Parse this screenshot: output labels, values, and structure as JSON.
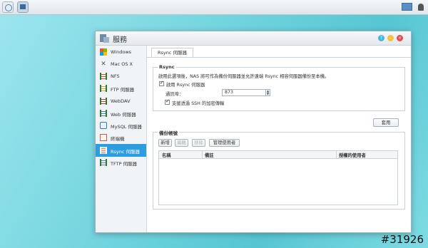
{
  "window": {
    "title": "服務"
  },
  "sidebar": {
    "items": [
      {
        "label": "Windows",
        "icon": "windows-icon"
      },
      {
        "label": "Mac OS X",
        "icon": "mac-icon"
      },
      {
        "label": "NFS",
        "icon": "nfs-icon"
      },
      {
        "label": "FTP 伺服器",
        "icon": "ftp-icon"
      },
      {
        "label": "WebDAV",
        "icon": "webdav-icon"
      },
      {
        "label": "Web 伺服器",
        "icon": "web-server-icon"
      },
      {
        "label": "MySQL 伺服器",
        "icon": "mysql-icon"
      },
      {
        "label": "終端機",
        "icon": "terminal-icon"
      },
      {
        "label": "Rsync 伺服器",
        "icon": "rsync-icon",
        "active": true
      },
      {
        "label": "TFTP 伺服器",
        "icon": "tftp-icon"
      }
    ]
  },
  "tabs": [
    {
      "label": "Rsync 伺服器"
    }
  ],
  "rsync": {
    "group_title": "Rsync",
    "description": "啟用此選項後，NAS 將可作為備份伺服器並允許遠端 Rsync 相容伺服器備份至本機。",
    "enable_label": "啟用 Rsync 伺服器",
    "enable_checked": true,
    "port_label": "通訊埠：",
    "port_value": "873",
    "ssh_label": "支援透過 SSH 的加密傳輸",
    "ssh_checked": true
  },
  "apply_label": "套用",
  "backup": {
    "group_title": "備份帳號",
    "buttons": {
      "add": "新增",
      "edit": "編輯",
      "remove": "移除",
      "manage": "管理使用者"
    },
    "columns": [
      "名稱",
      "備註",
      "授權的使用者"
    ]
  },
  "watermark": "#31926",
  "colors": {
    "accent": "#2d9de0",
    "close": "#e24c4c",
    "minimize": "#f5c23e",
    "help": "#44b6e0"
  }
}
